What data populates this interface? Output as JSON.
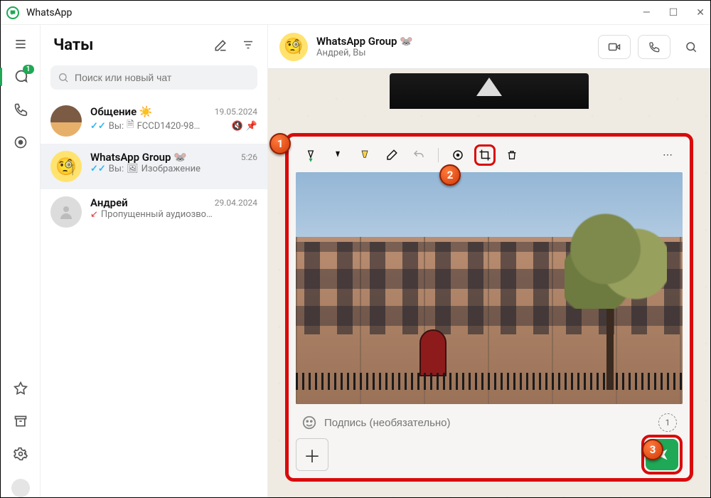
{
  "app": {
    "title": "WhatsApp"
  },
  "rail": {
    "chat_badge": "1"
  },
  "sidebar": {
    "title": "Чаты",
    "search_placeholder": "Поиск или новый чат"
  },
  "chats": [
    {
      "name": "Общение",
      "emoji": "☀️",
      "date": "19.05.2024",
      "you_prefix": "Вы:",
      "preview": "FCCD1420-98…",
      "doc_icon": true,
      "muted": true,
      "pinned": true
    },
    {
      "name": "WhatsApp Group",
      "emoji": "🐭",
      "date": "5:26",
      "you_prefix": "Вы:",
      "preview": "Изображение",
      "image_icon": true,
      "selected": true
    },
    {
      "name": "Андрей",
      "date": "29.04.2024",
      "preview": "Пропущенный аудиозво…",
      "missed_call": true
    }
  ],
  "header": {
    "title": "WhatsApp Group",
    "emoji": "🐭",
    "subtitle": "Андрей, Вы"
  },
  "editor": {
    "caption_placeholder": "Подпись (необязательно)",
    "view_once": "1"
  },
  "callouts": {
    "one": "1",
    "two": "2",
    "three": "3"
  }
}
